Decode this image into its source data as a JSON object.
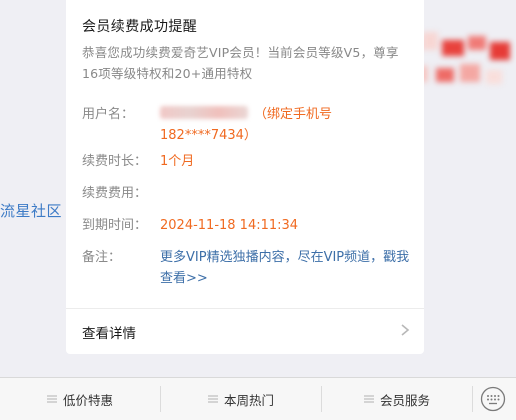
{
  "side_link": "流星社区",
  "card": {
    "title": "会员续费成功提醒",
    "description": "恭喜您成功续费爱奇艺VIP会员！当前会员等级V5，尊享16项等级特权和20+通用特权",
    "fields": {
      "username": {
        "label": "用户名：",
        "value": "（绑定手机号182****7434）"
      },
      "duration": {
        "label": "续费时长：",
        "value": "1个月"
      },
      "fee": {
        "label": "续费费用：",
        "value": ""
      },
      "expiry": {
        "label": "到期时间：",
        "value": "2024-11-18 14:11:34"
      },
      "remark": {
        "label": "备注：",
        "value": "更多VIP精选独播内容，尽在VIP频道，戳我查看>>"
      }
    },
    "detail_link": "查看详情"
  },
  "menu": {
    "items": [
      {
        "label": "低价特惠",
        "icon": "menu-lines-icon"
      },
      {
        "label": "本周热门",
        "icon": "menu-lines-icon"
      },
      {
        "label": "会员服务",
        "icon": "menu-lines-icon"
      }
    ],
    "keyboard_icon": "keyboard-icon"
  },
  "colors": {
    "accent_orange": "#f06a21",
    "link_blue": "#3d6fa8",
    "side_link_blue": "#3d7bc6",
    "background": "#efeff4"
  }
}
